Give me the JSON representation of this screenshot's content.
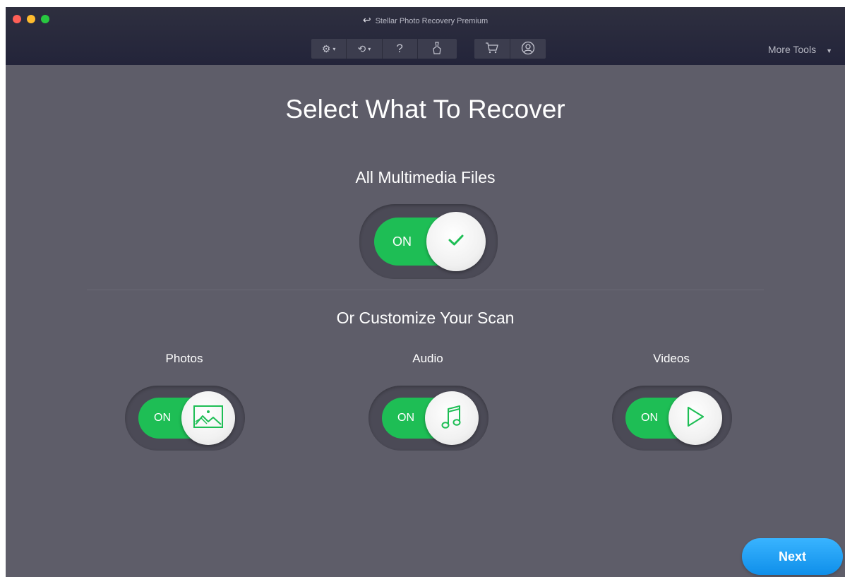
{
  "window": {
    "title": "Stellar Photo Recovery Premium",
    "back_icon": "back-arrow-icon"
  },
  "toolbar": {
    "items": [
      {
        "name": "settings",
        "icon": "gear-icon",
        "has_dropdown": true
      },
      {
        "name": "history",
        "icon": "history-icon",
        "has_dropdown": true
      },
      {
        "name": "help",
        "icon": "help-icon",
        "glyph": "?"
      },
      {
        "name": "clean",
        "icon": "clean-icon"
      },
      {
        "name": "cart",
        "icon": "cart-icon"
      },
      {
        "name": "account",
        "icon": "account-icon"
      }
    ],
    "more_tools_label": "More Tools"
  },
  "main": {
    "title": "Select What To Recover",
    "all_files": {
      "label": "All Multimedia Files",
      "toggle_text": "ON",
      "state": "on",
      "icon": "checkmark-icon"
    },
    "customize_label": "Or Customize Your Scan",
    "categories": [
      {
        "label": "Photos",
        "toggle_text": "ON",
        "state": "on",
        "icon": "image-icon"
      },
      {
        "label": "Audio",
        "toggle_text": "ON",
        "state": "on",
        "icon": "music-note-icon"
      },
      {
        "label": "Videos",
        "toggle_text": "ON",
        "state": "on",
        "icon": "play-icon"
      }
    ]
  },
  "next_button": {
    "label": "Next"
  },
  "colors": {
    "accent_green": "#1ebe55",
    "next_blue": "#1a9cf2",
    "background": "#5e5d69",
    "titlebar": "#2a2b3c"
  }
}
